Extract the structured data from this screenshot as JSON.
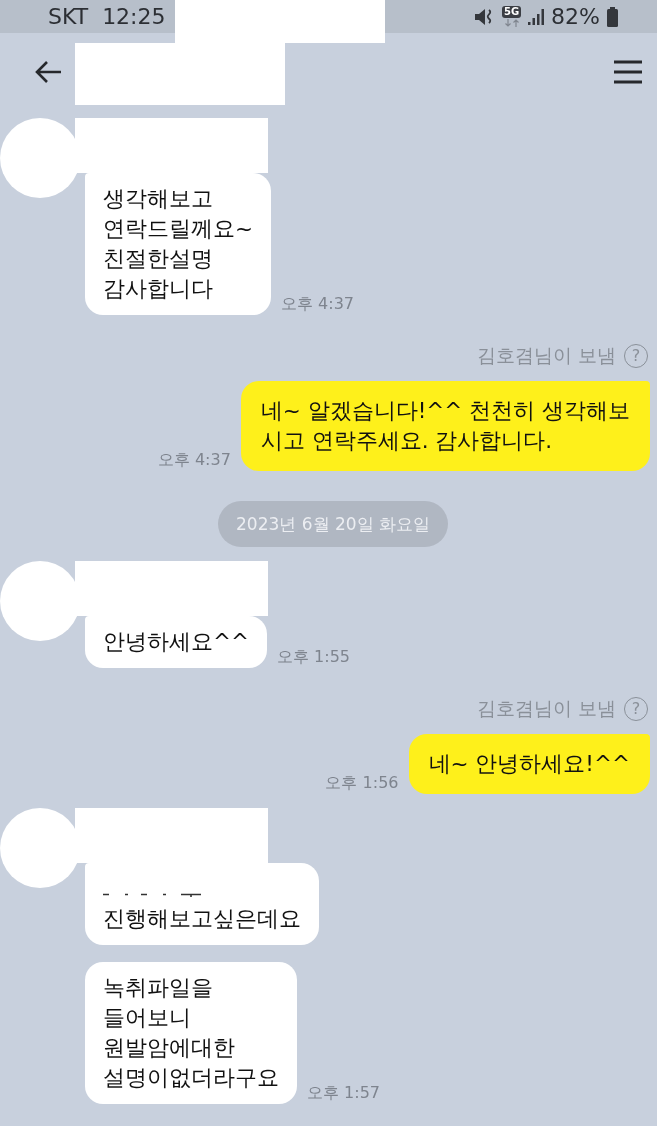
{
  "status_bar": {
    "carrier": "SKT",
    "time": "12:25",
    "network": "5G",
    "battery": "82%"
  },
  "messages": [
    {
      "kind": "received",
      "bubbles": [
        {
          "text": "생각해보고\n연락드릴께요~\n친절한설명\n감사합니다",
          "clipped_top": false
        }
      ],
      "time": "오후 4:37"
    },
    {
      "kind": "sent",
      "sender_note": "김호겸님이 보냄",
      "help_mark": "?",
      "bubbles": [
        {
          "text": "네~ 알겠습니다!^^ 천천히 생각해보\n시고 연락주세요. 감사합니다."
        }
      ],
      "time": "오후 4:37"
    },
    {
      "kind": "date",
      "text": "2023년 6월 20일 화요일"
    },
    {
      "kind": "received",
      "bubbles": [
        {
          "text": "안녕하세요^^",
          "clipped_top": false
        }
      ],
      "time": "오후 1:55"
    },
    {
      "kind": "sent",
      "sender_note": "김호겸님이 보냄",
      "help_mark": "?",
      "bubbles": [
        {
          "text": "네~ 안녕하세요!^^"
        }
      ],
      "time": "오후 1:56"
    },
    {
      "kind": "received",
      "bubbles": [
        {
          "text": "진행해보고싶은데요",
          "clipped_top": true
        },
        {
          "text": "녹취파일을\n들어보니\n원발암에대한\n설명이없더라구요",
          "clipped_top": false
        }
      ],
      "time": "오후 1:57"
    }
  ]
}
